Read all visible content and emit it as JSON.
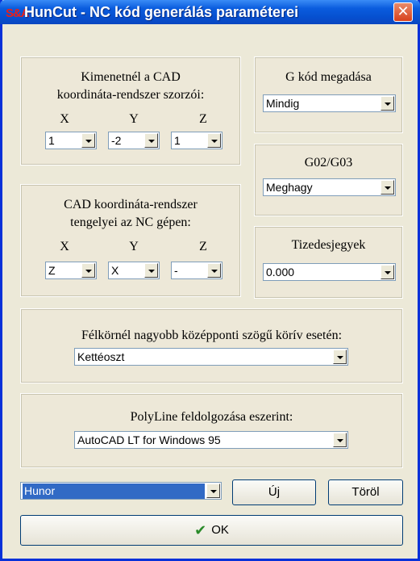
{
  "window": {
    "title": "HunCut - NC kód generálás paraméterei",
    "icon": "S&A"
  },
  "multipliers": {
    "label_line1": "Kimenetnél a CAD",
    "label_line2": "koordináta-rendszer szorzói:",
    "axes": [
      "X",
      "Y",
      "Z"
    ],
    "values": [
      "1",
      "-2",
      "1"
    ]
  },
  "axes_map": {
    "label_line1": "CAD koordináta-rendszer",
    "label_line2": "tengelyei az NC gépen:",
    "axes": [
      "X",
      "Y",
      "Z"
    ],
    "values": [
      "Z",
      "X",
      "-"
    ]
  },
  "gcode": {
    "label": "G kód megadása",
    "value": "Mindig"
  },
  "g02g03": {
    "label": "G02/G03",
    "value": "Meghagy"
  },
  "decimals": {
    "label": "Tizedesjegyek",
    "value": "0.000"
  },
  "arc": {
    "label": "Félkörnél nagyobb középponti szögű körív esetén:",
    "value": "Kettéoszt"
  },
  "polyline": {
    "label": "PolyLine feldolgozása eszerint:",
    "value": "AutoCAD LT for Windows 95"
  },
  "profile": {
    "value": "Hunor"
  },
  "buttons": {
    "new": "Új",
    "delete": "Töröl",
    "ok": "OK"
  }
}
